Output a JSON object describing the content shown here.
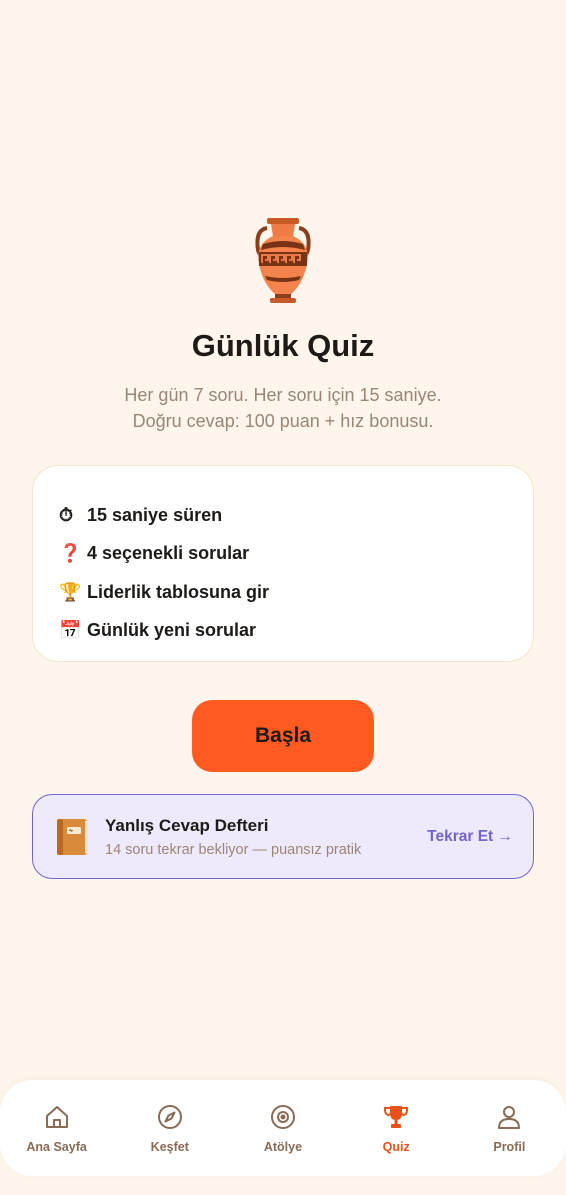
{
  "hero": {
    "icon": "amphora-icon",
    "title": "Günlük Quiz",
    "subtitle_line1": "Her gün 7 soru. Her soru için 15 saniye.",
    "subtitle_line2": "Doğru cevap: 100 puan + hız bonusu."
  },
  "features": [
    {
      "icon": "stopwatch-icon",
      "emoji": "⏱",
      "label": "15 saniye süren"
    },
    {
      "icon": "question-mark-icon",
      "emoji": "❓",
      "label": "4 seçenekli sorular"
    },
    {
      "icon": "trophy-icon",
      "emoji": "🏆",
      "label": "Liderlik tablosuna gir"
    },
    {
      "icon": "calendar-icon",
      "emoji": "📅",
      "label": "Günlük yeni sorular"
    }
  ],
  "start_button": {
    "label": "Başla"
  },
  "review": {
    "icon": "notebook-icon",
    "title": "Yanlış Cevap Defteri",
    "subtitle": "14 soru tekrar bekliyor — puansız pratik",
    "cta": "Tekrar Et →"
  },
  "nav": {
    "items": [
      {
        "icon": "home-icon",
        "label": "Ana Sayfa",
        "active": false
      },
      {
        "icon": "compass-icon",
        "label": "Keşfet",
        "active": false
      },
      {
        "icon": "target-icon",
        "label": "Atölye",
        "active": false
      },
      {
        "icon": "trophy-icon",
        "label": "Quiz",
        "active": true
      },
      {
        "icon": "user-icon",
        "label": "Profil",
        "active": false
      }
    ]
  },
  "colors": {
    "background": "#FEF6EC",
    "accent": "#FF5A1F",
    "active_nav": "#E8521B",
    "review_accent": "#7166CC",
    "muted_text": "#9A8676"
  }
}
